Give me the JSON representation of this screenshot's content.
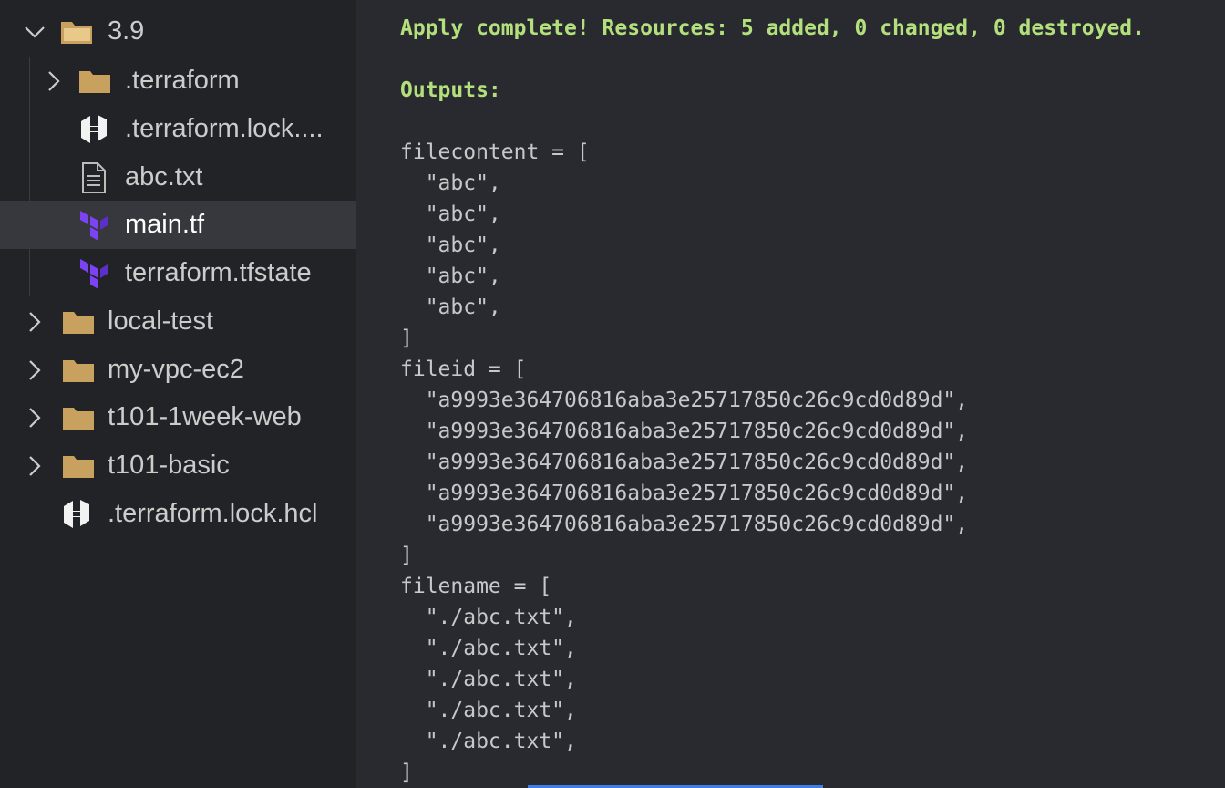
{
  "explorer": {
    "items": [
      {
        "label": "3.9",
        "icon": "folder-open-icon",
        "expanded": true
      },
      {
        "label": ".terraform",
        "icon": "folder-icon",
        "expanded": false
      },
      {
        "label": ".terraform.lock....",
        "icon": "hashicorp-icon"
      },
      {
        "label": "abc.txt",
        "icon": "text-file-icon"
      },
      {
        "label": "main.tf",
        "icon": "terraform-icon",
        "selected": true
      },
      {
        "label": "terraform.tfstate",
        "icon": "terraform-icon"
      },
      {
        "label": "local-test",
        "icon": "folder-icon",
        "expanded": false
      },
      {
        "label": "my-vpc-ec2",
        "icon": "folder-icon",
        "expanded": false
      },
      {
        "label": "t101-1week-web",
        "icon": "folder-icon",
        "expanded": false
      },
      {
        "label": "t101-basic",
        "icon": "folder-icon",
        "expanded": false
      },
      {
        "label": ".terraform.lock.hcl",
        "icon": "hashicorp-icon"
      }
    ]
  },
  "terminal": {
    "lines": [
      "Apply complete! Resources: 5 added, 0 changed, 0 destroyed.",
      "",
      "Outputs:",
      "",
      "filecontent = [",
      "  \"abc\",",
      "  \"abc\",",
      "  \"abc\",",
      "  \"abc\",",
      "  \"abc\",",
      "]",
      "fileid = [",
      "  \"a9993e364706816aba3e25717850c26c9cd0d89d\",",
      "  \"a9993e364706816aba3e25717850c26c9cd0d89d\",",
      "  \"a9993e364706816aba3e25717850c26c9cd0d89d\",",
      "  \"a9993e364706816aba3e25717850c26c9cd0d89d\",",
      "  \"a9993e364706816aba3e25717850c26c9cd0d89d\",",
      "]",
      "filename = [",
      "  \"./abc.txt\",",
      "  \"./abc.txt\",",
      "  \"./abc.txt\",",
      "  \"./abc.txt\",",
      "  \"./abc.txt\",",
      "]"
    ]
  },
  "colors": {
    "terminal_bg": "#282a2f",
    "sidebar_bg": "#222326",
    "selected_row": "#37383e",
    "success_text": "#b3e07c",
    "output_text": "#c6c8cc",
    "folder": "#c9a15f",
    "terraform": "#7b42f6"
  }
}
